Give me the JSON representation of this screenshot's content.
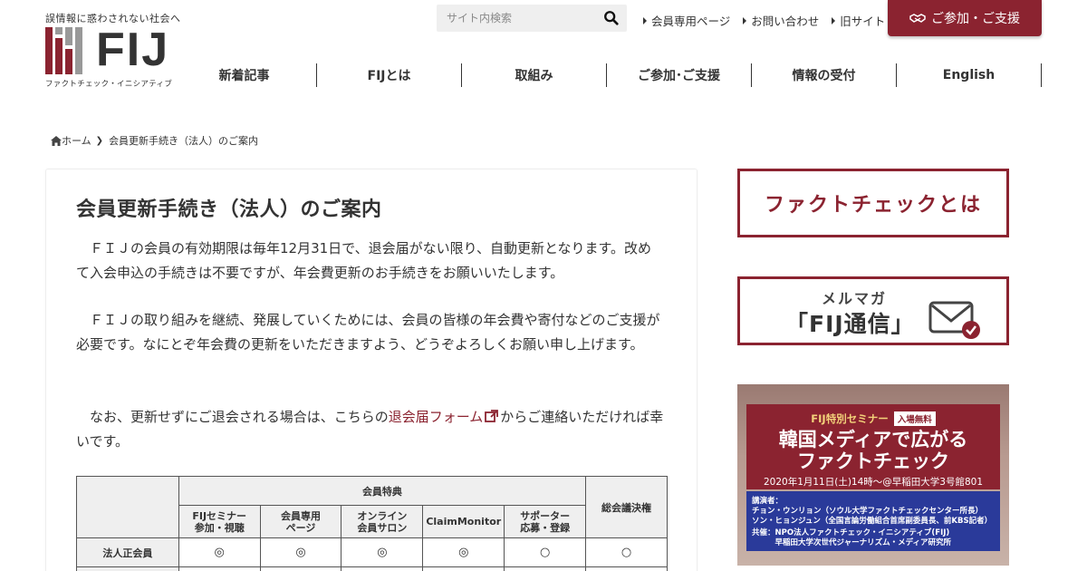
{
  "header": {
    "tagline": "誤情報に惑わされない社会へ",
    "logo_text": "FIJ",
    "logo_sub": "ファクトチェック・イニシアティブ",
    "search_placeholder": "サイト内検索",
    "util_links": [
      "会員専用ページ",
      "お問い合わせ",
      "旧サイト"
    ],
    "join_label": "ご参加・ご支援",
    "nav": [
      "新着記事",
      "FIJとは",
      "取組み",
      "ご参加･ご支援",
      "情報の受付",
      "English"
    ]
  },
  "breadcrumb": {
    "home": "ホーム",
    "current": "会員更新手続き（法人）のご案内"
  },
  "article": {
    "title": "会員更新手続き（法人）のご案内",
    "p1": "　ＦＩＪの会員の有効期限は毎年12月31日で、退会届がない限り、自動更新となります。改めて入会申込の手続きは不要ですが、年会費更新のお手続きをお願いいたします。",
    "p2": "　ＦＩＪの取り組みを継続、発展していくためには、会員の皆様の年会費や寄付などのご支援が必要です。なにとぞ年会費の更新をいただきますよう、どうぞよろしくお願い申し上げます。",
    "p3_before": "　なお、更新せずにご退会される場合は、こちらの",
    "p3_link": "退会届フォーム",
    "p3_after": "からご連絡いただければ幸いです。"
  },
  "table": {
    "group_header": "会員特典",
    "vote_header": "総会議決権",
    "columns": [
      "FIJセミナー\n参加・視聴",
      "会員専用\nページ",
      "オンライン\n会員サロン",
      "ClaimMonitor",
      "サポーター\n応募・登録"
    ],
    "rows": [
      {
        "label": "法人正会員",
        "values": [
          "◎",
          "◎",
          "◎",
          "◎",
          "○",
          "○"
        ]
      }
    ]
  },
  "sidebar": {
    "banner1": "ファクトチェックとは",
    "banner2_top": "メルマガ",
    "banner2_main": "「FIJ通信」",
    "banner3_line1": "FIJ特別セミナー",
    "banner3_badge": "入場無料",
    "banner3_title1": "韓国メディアで広がる",
    "banner3_title2": "ファクトチェック",
    "banner3_date": "2020年1月11日(土)14時～@早稲田大学3号館801",
    "banner3_speakers_label": "講演者：",
    "banner3_speaker1": "チョン・ウンリョン（ソウル大学ファクトチェックセンター所長）",
    "banner3_speaker2": "ソン・ヒョンジュン（全国言論労働組合首席副委員長、前KBS記者）",
    "banner3_host1": "共催：NPO法人ファクトチェック・イニシアティブ(FIJ)",
    "banner3_host2": "　　　早稲田大学次世代ジャーナリズム・メディア研究所"
  },
  "colors": {
    "brand": "#8b2330",
    "text": "#333333",
    "seminar_blue": "#2a3a9a"
  }
}
